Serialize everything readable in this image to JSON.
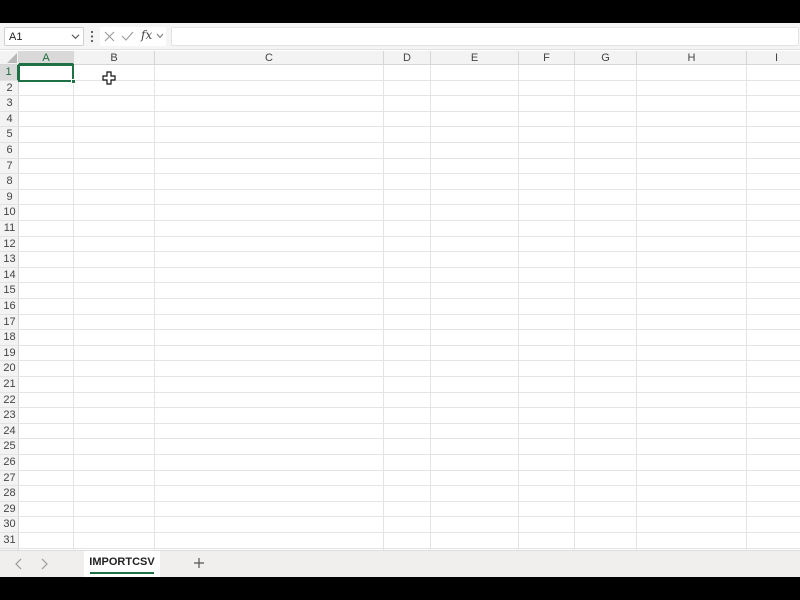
{
  "formula_bar": {
    "name_box_value": "A1",
    "function_label": "fx",
    "formula_value": ""
  },
  "columns": [
    "A",
    "B",
    "C",
    "D",
    "E",
    "F",
    "G",
    "H",
    "I"
  ],
  "selected_column": "A",
  "rows": [
    "1",
    "2",
    "3",
    "4",
    "5",
    "6",
    "7",
    "8",
    "9",
    "10",
    "11",
    "12",
    "13",
    "14",
    "15",
    "16",
    "17",
    "18",
    "19",
    "20",
    "21",
    "22",
    "23",
    "24",
    "25",
    "26",
    "27",
    "28",
    "29",
    "30",
    "31"
  ],
  "selected_row": "1",
  "active_cell": "A1",
  "sheet_tabs": [
    {
      "label": "IMPORTCSV",
      "active": true
    }
  ],
  "colors": {
    "accent": "#1e7145",
    "header_bg": "#f3f3f3",
    "gridline": "#e4e4e4"
  },
  "icons": {
    "name_box_dropdown": "chevron-down-icon",
    "formula_options": "more-vertical-icon",
    "cancel": "close-icon",
    "enter": "checkmark-icon",
    "expand_formula": "chevron-down-icon",
    "select_all": "select-all-triangle-icon",
    "cursor": "cell-select-cursor-icon",
    "prev_sheet": "chevron-left-icon",
    "next_sheet": "chevron-right-icon",
    "add_sheet": "plus-icon"
  }
}
